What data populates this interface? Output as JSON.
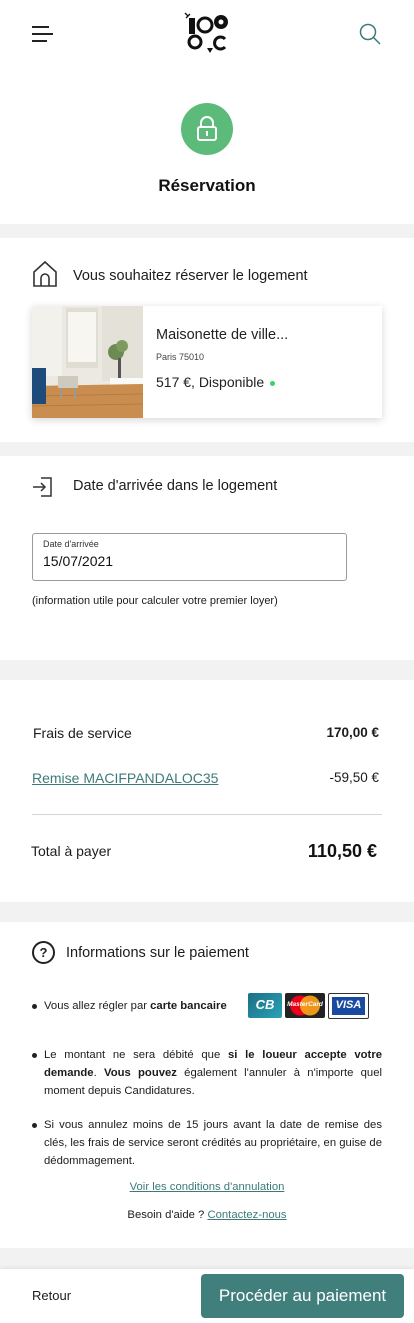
{
  "header": {
    "logo_text": "loc"
  },
  "page": {
    "title": "Réservation"
  },
  "listing_section": {
    "heading": "Vous souhaitez réserver le logement",
    "listing": {
      "title": "Maisonette de ville...",
      "city": "Paris 75010",
      "price_status": "517 €, Disponible",
      "status_color": "#3ccf6a"
    }
  },
  "arrival_section": {
    "heading": "Date d'arrivée dans le logement",
    "field_label": "Date d'arrivée",
    "field_value": "15/07/2021",
    "info": "(information utile pour calculer votre premier loyer)"
  },
  "summary": {
    "fee_label": "Frais de service",
    "fee_value": "170,00 €",
    "promo_label": "Remise MACIFPANDALOC35",
    "promo_value": "-59,50 €",
    "total_label": "Total à payer",
    "total_value": "110,50 €"
  },
  "payment_info": {
    "heading": "Informations sur le paiement",
    "card_brands": [
      "CB",
      "MasterCard",
      "VISA"
    ],
    "b1_pre": "Vous allez régler par ",
    "b1_bold": "carte bancaire",
    "b2_pre": "Le montant ne sera débité que ",
    "b2_bold1": "si le loueur accepte votre demande",
    "b2_mid": ". ",
    "b2_bold2": "Vous pouvez",
    "b2_post": " également l'annuler à n'importe quel moment depuis Candidatures.",
    "b3": "Si vous annulez moins de 15 jours avant la date de remise des clés, les frais de service seront crédités au propriétaire, en guise de dédommagement.",
    "conditions_link": "Voir les conditions d'annulation",
    "help_text": "Besoin d'aide ?",
    "contact_link": "Contactez-nous"
  },
  "footer": {
    "back_label": "Retour",
    "pay_label": "Procéder au paiement"
  },
  "colors": {
    "accent": "#417f7c",
    "link": "#3d7a7a",
    "lock_green": "#5cbb7a"
  }
}
